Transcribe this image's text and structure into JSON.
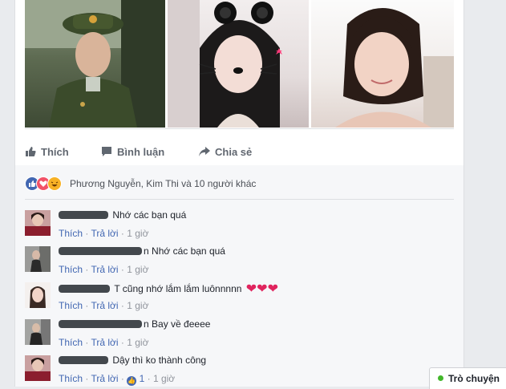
{
  "post_actions": {
    "like_label": "Thích",
    "comment_label": "Bình luận",
    "share_label": "Chia sẻ"
  },
  "reactions": {
    "summary": "Phương Nguyễn, Kim Thi và 10 người khác"
  },
  "comments": [
    {
      "name_suffix": "",
      "text": "Nhớ các bạn quá",
      "like": "Thích",
      "reply": "Trả lời",
      "time": "1 giờ",
      "hearts": "",
      "likes": ""
    },
    {
      "name_suffix": "n",
      "text": "Nhớ các bạn quá",
      "like": "Thích",
      "reply": "Trả lời",
      "time": "1 giờ",
      "hearts": "",
      "likes": ""
    },
    {
      "name_suffix": "",
      "text": "T cũng nhớ lắm lắm luônnnnn",
      "like": "Thích",
      "reply": "Trả lời",
      "time": "1 giờ",
      "hearts": "❤❤❤",
      "likes": ""
    },
    {
      "name_suffix": "n",
      "text": "Bay về đeeee",
      "like": "Thích",
      "reply": "Trả lời",
      "time": "1 giờ",
      "hearts": "",
      "likes": ""
    },
    {
      "name_suffix": "",
      "text": "Dậy thì ko thành công",
      "like": "Thích",
      "reply": "Trả lời",
      "time": "1 giờ",
      "hearts": "",
      "likes": "1"
    }
  ],
  "chat": {
    "label": "Trò chuyện"
  },
  "colors": {
    "link": "#4267b2",
    "muted": "#90949c",
    "heart": "#e0245e",
    "online": "#42b72a"
  }
}
